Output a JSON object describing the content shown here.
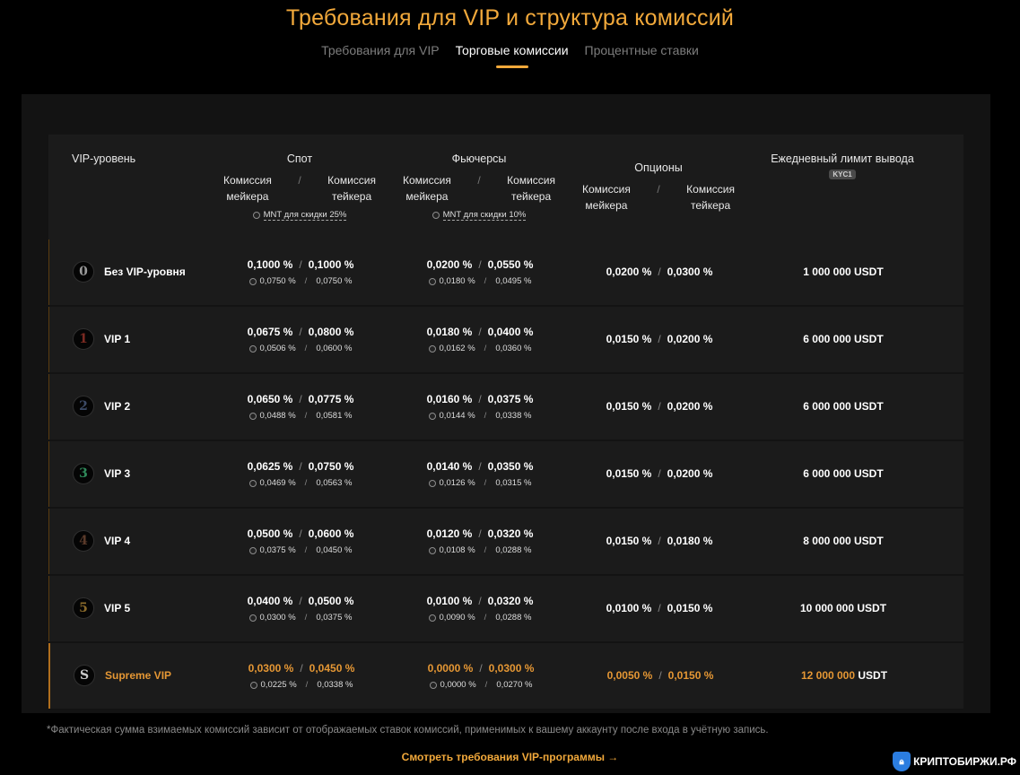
{
  "title": "Требования для VIP и структура комиссий",
  "tabs": [
    {
      "label": "Требования для VIP",
      "active": false
    },
    {
      "label": "Торговые комиссии",
      "active": true
    },
    {
      "label": "Процентные ставки",
      "active": false
    }
  ],
  "header": {
    "vip_level": "VIP-уровень",
    "spot": "Спот",
    "futures": "Фьючерсы",
    "options": "Опционы",
    "withdraw": "Ежедневный лимит вывода",
    "kyc": "KYC1",
    "maker_l1": "Комиссия",
    "maker_l2": "мейкера",
    "taker_l1": "Комиссия",
    "taker_l2": "тейкера",
    "spot_discount": "MNT для скидки 25%",
    "futures_discount": "MNT для скидки 10%",
    "slash": "/"
  },
  "rows": [
    {
      "badge": "0",
      "badge_color": "#9a9a9a",
      "name": "Без VIP-уровня",
      "spot_maker": "0,1000 %",
      "spot_taker": "0,1000 %",
      "spot_maker_d": "0,0750 %",
      "spot_taker_d": "0,0750 %",
      "fut_maker": "0,0200 %",
      "fut_taker": "0,0550 %",
      "fut_maker_d": "0,0180 %",
      "fut_taker_d": "0,0495 %",
      "opt_maker": "0,0200 %",
      "opt_taker": "0,0300 %",
      "withdraw": "1 000 000 USDT"
    },
    {
      "badge": "1",
      "badge_color": "#7a2a22",
      "name": "VIP 1",
      "spot_maker": "0,0675 %",
      "spot_taker": "0,0800 %",
      "spot_maker_d": "0,0506 %",
      "spot_taker_d": "0,0600 %",
      "fut_maker": "0,0180 %",
      "fut_taker": "0,0400 %",
      "fut_maker_d": "0,0162 %",
      "fut_taker_d": "0,0360 %",
      "opt_maker": "0,0150 %",
      "opt_taker": "0,0200 %",
      "withdraw": "6 000 000 USDT"
    },
    {
      "badge": "2",
      "badge_color": "#3c4a66",
      "name": "VIP 2",
      "spot_maker": "0,0650 %",
      "spot_taker": "0,0775 %",
      "spot_maker_d": "0,0488 %",
      "spot_taker_d": "0,0581 %",
      "fut_maker": "0,0160 %",
      "fut_taker": "0,0375 %",
      "fut_maker_d": "0,0144 %",
      "fut_taker_d": "0,0338 %",
      "opt_maker": "0,0150 %",
      "opt_taker": "0,0200 %",
      "withdraw": "6 000 000 USDT"
    },
    {
      "badge": "3",
      "badge_color": "#2f8a5a",
      "name": "VIP 3",
      "spot_maker": "0,0625 %",
      "spot_taker": "0,0750 %",
      "spot_maker_d": "0,0469 %",
      "spot_taker_d": "0,0563 %",
      "fut_maker": "0,0140 %",
      "fut_taker": "0,0350 %",
      "fut_maker_d": "0,0126 %",
      "fut_taker_d": "0,0315 %",
      "opt_maker": "0,0150 %",
      "opt_taker": "0,0200 %",
      "withdraw": "6 000 000 USDT"
    },
    {
      "badge": "4",
      "badge_color": "#5a3a2a",
      "name": "VIP 4",
      "spot_maker": "0,0500 %",
      "spot_taker": "0,0600 %",
      "spot_maker_d": "0,0375 %",
      "spot_taker_d": "0,0450 %",
      "fut_maker": "0,0120 %",
      "fut_taker": "0,0320 %",
      "fut_maker_d": "0,0108 %",
      "fut_taker_d": "0,0288 %",
      "opt_maker": "0,0150 %",
      "opt_taker": "0,0180 %",
      "withdraw": "8 000 000 USDT"
    },
    {
      "badge": "5",
      "badge_color": "#8a6a2a",
      "name": "VIP 5",
      "spot_maker": "0,0400 %",
      "spot_taker": "0,0500 %",
      "spot_maker_d": "0,0300 %",
      "spot_taker_d": "0,0375 %",
      "fut_maker": "0,0100 %",
      "fut_taker": "0,0320 %",
      "fut_maker_d": "0,0090 %",
      "fut_taker_d": "0,0288 %",
      "opt_maker": "0,0100 %",
      "opt_taker": "0,0150 %",
      "withdraw": "10 000 000 USDT"
    }
  ],
  "supreme": {
    "badge": "S",
    "badge_color": "#c9c9c9",
    "name": "Supreme VIP",
    "spot_maker": "0,0300 %",
    "spot_taker": "0,0450 %",
    "spot_maker_d": "0,0225 %",
    "spot_taker_d": "0,0338 %",
    "fut_maker": "0,0000 %",
    "fut_taker": "0,0300 %",
    "fut_maker_d": "0,0000 %",
    "fut_taker_d": "0,0270 %",
    "opt_maker": "0,0050 %",
    "opt_taker": "0,0150 %",
    "withdraw": "12 000 000 USDT"
  },
  "footnote": "*Фактическая сумма взимаемых комиссий зависит от отображаемых ставок комиссий, применимых к вашему аккаунту после входа в учётную запись.",
  "vip_link": "Смотреть требования VIP-программы  →",
  "watermark": "КРИПТОБИРЖИ.РФ",
  "colors": {
    "accent": "#f2a93b",
    "background": "#000000",
    "panel": "#131313",
    "row": "#1b1b1b"
  }
}
